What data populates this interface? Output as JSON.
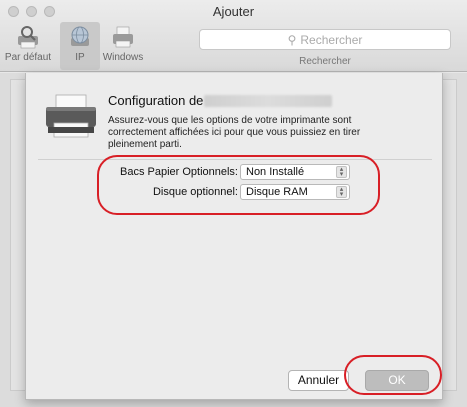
{
  "window": {
    "title": "Ajouter"
  },
  "toolbar": {
    "items": [
      {
        "label": "Par défaut",
        "icon": "magnifier-printer-icon"
      },
      {
        "label": "IP",
        "icon": "globe-icon",
        "selected": true
      },
      {
        "label": "Windows",
        "icon": "windows-printer-icon"
      }
    ],
    "search_placeholder": "Rechercher",
    "search_caption": "Rechercher"
  },
  "sheet": {
    "title": "Configuration de",
    "description": "Assurez-vous que les options de votre imprimante sont correctement affichées ici pour que vous puissiez en tirer pleinement parti.",
    "options": [
      {
        "label": "Bacs Papier Optionnels:",
        "value": "Non Installé"
      },
      {
        "label": "Disque optionnel:",
        "value": "Disque RAM"
      }
    ],
    "cancel_label": "Annuler",
    "ok_label": "OK"
  },
  "colors": {
    "annotation": "#d81f26",
    "ok_disabled": "#bdbdbd"
  }
}
